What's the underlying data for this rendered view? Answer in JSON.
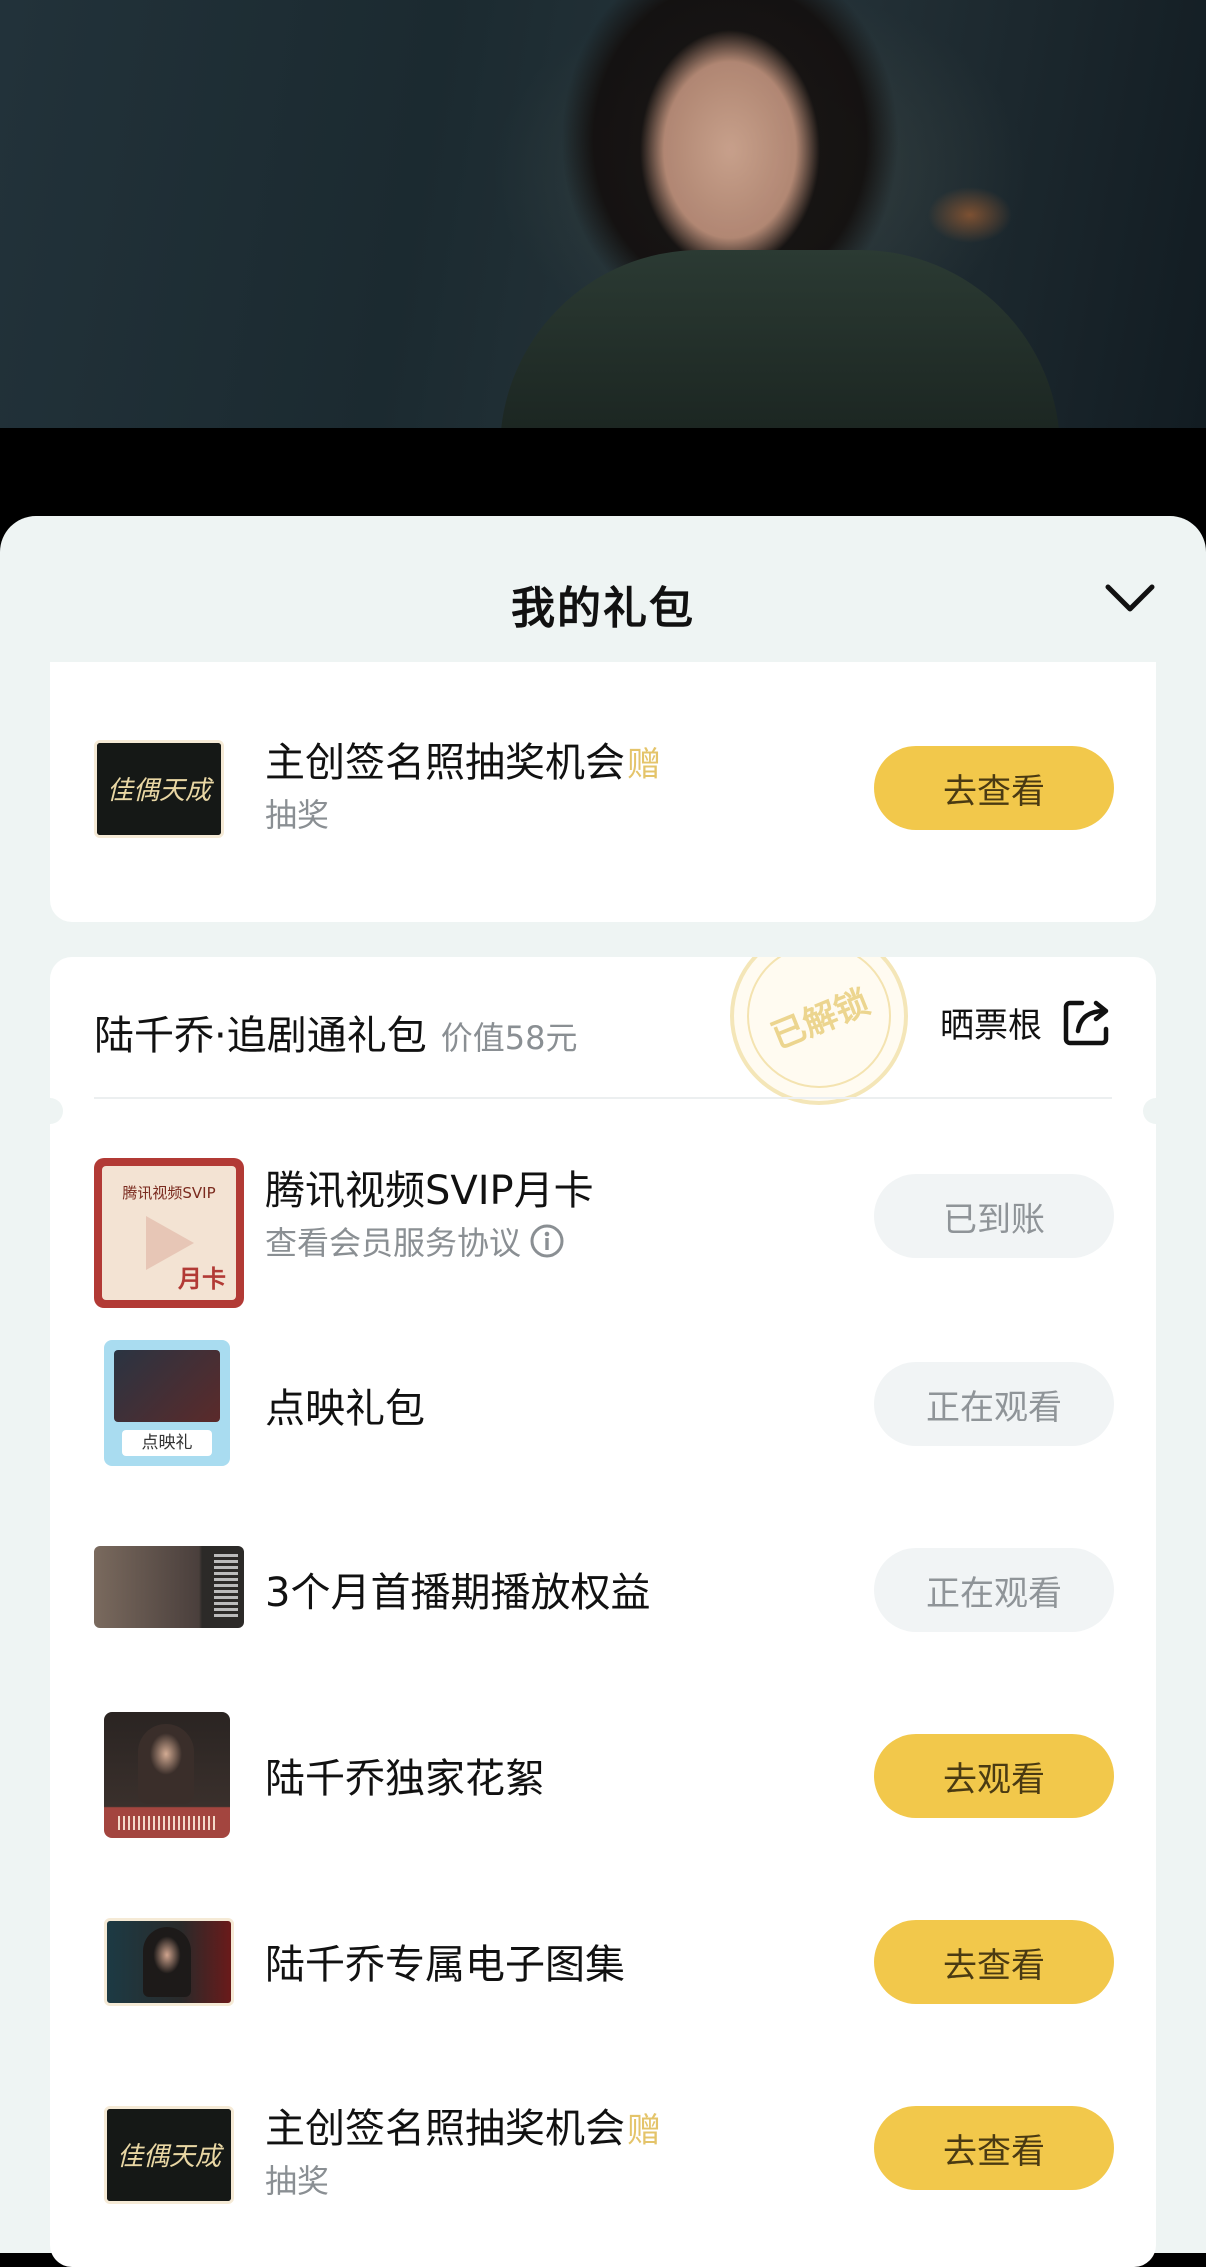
{
  "sheet": {
    "title": "我的礼包",
    "collapse_icon": "chevron-down-icon"
  },
  "top_item": {
    "title": "主创签名照抽奖机会",
    "tag": "赠",
    "subtitle": "抽奖",
    "button": "去查看",
    "thumb_text": "佳偶天成"
  },
  "bundle": {
    "name": "陆千乔·追剧通礼包",
    "value": "价值58元",
    "stamp": "已解锁",
    "share_label": "晒票根",
    "share_icon": "share-icon",
    "items": [
      {
        "title": "腾讯视频SVIP月卡",
        "subtitle": "查看会员服务协议",
        "button": "已到账",
        "state": "done",
        "thumb_top": "腾讯视频SVIP",
        "thumb_bottom": "月卡"
      },
      {
        "title": "点映礼包",
        "subtitle": "",
        "button": "正在观看",
        "state": "done",
        "thumb_bottom": "点映礼"
      },
      {
        "title": "3个月首播期播放权益",
        "subtitle": "",
        "button": "正在观看",
        "state": "done"
      },
      {
        "title": "陆千乔独家花絮",
        "subtitle": "",
        "button": "去观看",
        "state": "go"
      },
      {
        "title": "陆千乔专属电子图集",
        "subtitle": "",
        "button": "去查看",
        "state": "go"
      },
      {
        "title": "主创签名照抽奖机会",
        "tag": "赠",
        "subtitle": "抽奖",
        "button": "去查看",
        "state": "go",
        "thumb_text": "佳偶天成"
      }
    ]
  },
  "colors": {
    "accent_button": "#f2c84b",
    "disabled_button": "#f1f4f5",
    "tag": "#e4c46a",
    "sheet_bg": "#eef4f3"
  }
}
